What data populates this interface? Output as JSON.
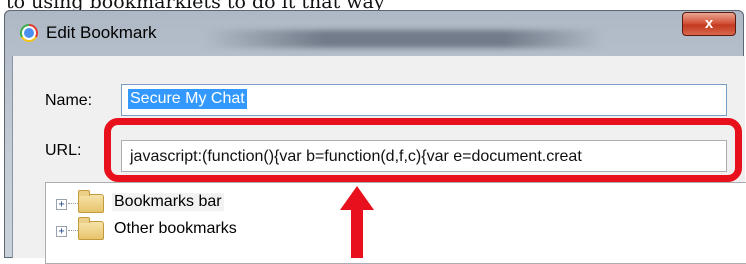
{
  "caption_text": "to using bookmarklets to do it that way",
  "dialog": {
    "title": "Edit Bookmark",
    "close_label": "x",
    "name_label": "Name:",
    "name_value": "Secure My Chat",
    "url_label": "URL:",
    "url_value": "javascript:(function(){var b=function(d,f,c){var e=document.creat",
    "folders": [
      {
        "label": "Bookmarks bar",
        "expander": "+",
        "icon": "folder-open-icon"
      },
      {
        "label": "Other bookmarks",
        "expander": "+",
        "icon": "folder-icon"
      }
    ]
  },
  "colors": {
    "highlight": "#e8101c",
    "selection": "#3399ff",
    "close_button": "#c23a20"
  }
}
